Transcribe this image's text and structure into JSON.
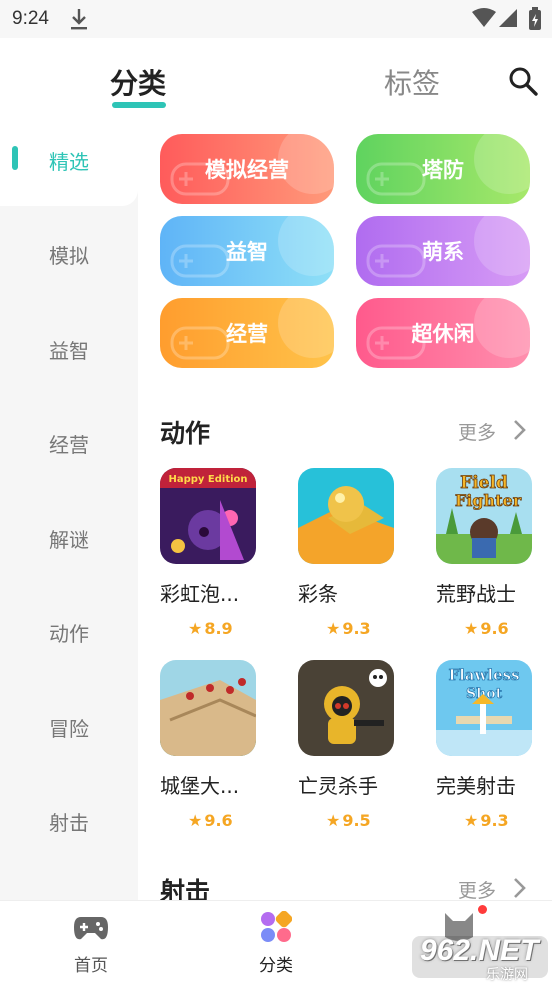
{
  "status": {
    "time": "9:24"
  },
  "header": {
    "tab_active": "分类",
    "tab_other": "标签"
  },
  "sidebar": {
    "items": [
      {
        "label": "精选"
      },
      {
        "label": "模拟"
      },
      {
        "label": "益智"
      },
      {
        "label": "经营"
      },
      {
        "label": "解谜"
      },
      {
        "label": "动作"
      },
      {
        "label": "冒险"
      },
      {
        "label": "射击"
      }
    ]
  },
  "categories": [
    {
      "label": "模拟经营",
      "color_from": "#ff5b5b",
      "color_to": "#ff9a7a"
    },
    {
      "label": "塔防",
      "color_from": "#5fd35f",
      "color_to": "#a7e86a"
    },
    {
      "label": "益智",
      "color_from": "#5fb4f7",
      "color_to": "#8fe0f7"
    },
    {
      "label": "萌系",
      "color_from": "#b06cf0",
      "color_to": "#d79cf5"
    },
    {
      "label": "经营",
      "color_from": "#ff9d2e",
      "color_to": "#ffc34a"
    },
    {
      "label": "超休闲",
      "color_from": "#ff5a8c",
      "color_to": "#ff8fae"
    }
  ],
  "sections": [
    {
      "title": "动作",
      "more": "更多",
      "games": [
        {
          "name": "彩虹泡...",
          "rating": "8.9"
        },
        {
          "name": "彩条",
          "rating": "9.3"
        },
        {
          "name": "荒野战士",
          "rating": "9.6"
        },
        {
          "name": "城堡大...",
          "rating": "9.6"
        },
        {
          "name": "亡灵杀手",
          "rating": "9.5"
        },
        {
          "name": "完美射击",
          "rating": "9.3"
        }
      ]
    },
    {
      "title": "射击",
      "more": "更多"
    }
  ],
  "icon_texts": {
    "happy": "Happy Edition",
    "field": "Field",
    "fighter": "Fighter",
    "flawless": "Flawless",
    "shot": "Shot"
  },
  "nav": {
    "home": "首页",
    "category": "分类"
  },
  "watermark": {
    "main": "962.NET",
    "sub": "乐游网"
  },
  "colors": {
    "accent": "#2ec4b6",
    "star": "#f5a623"
  }
}
